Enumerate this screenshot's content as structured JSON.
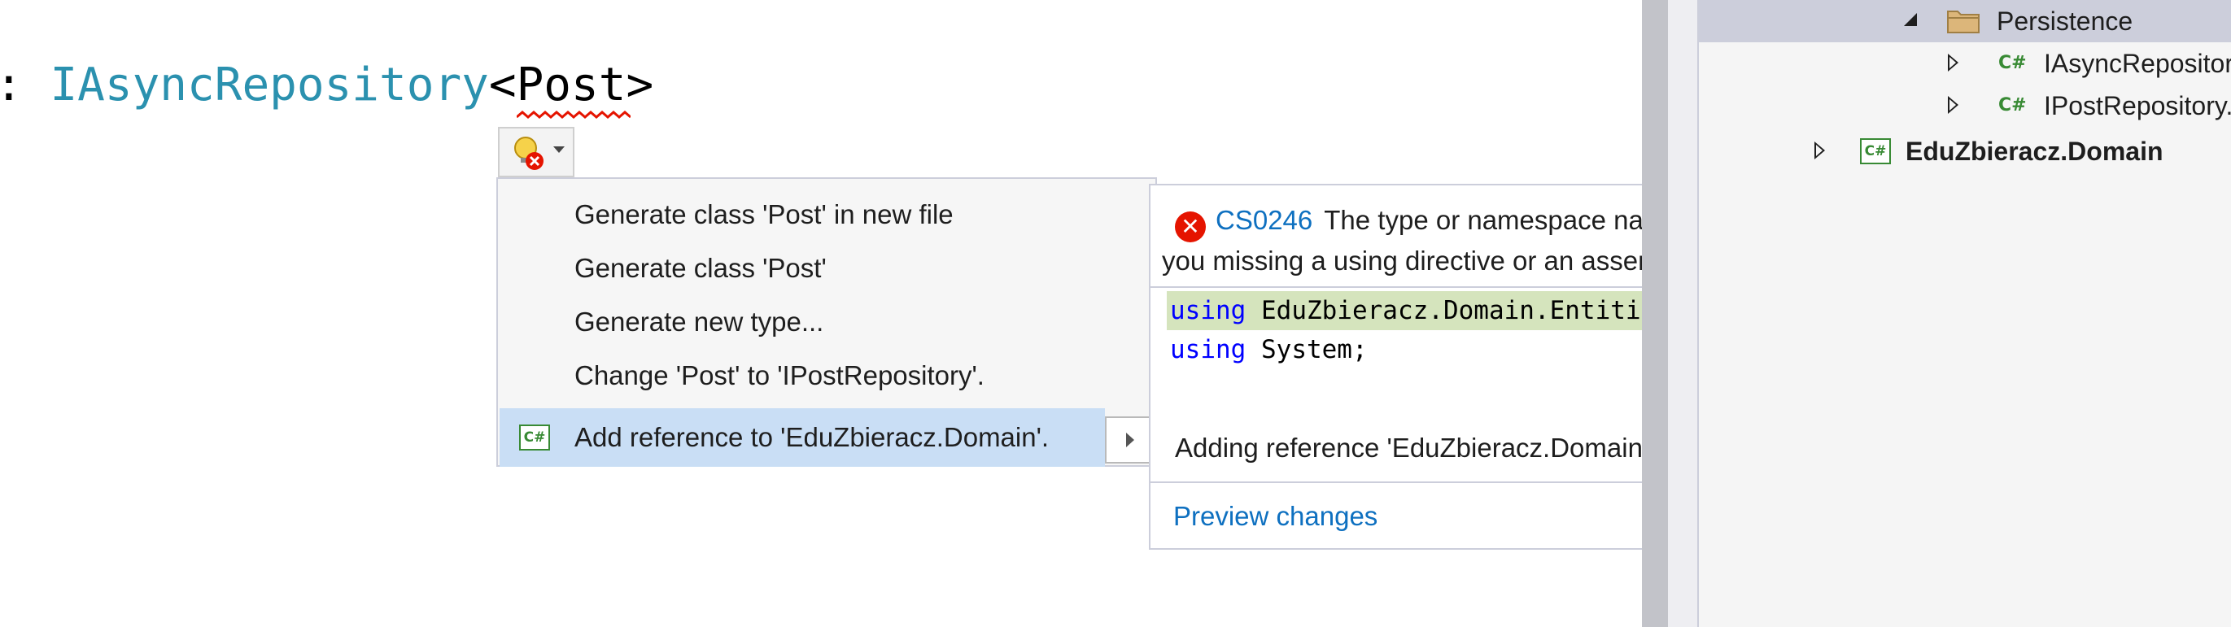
{
  "editor": {
    "code": {
      "colon": ": ",
      "interface": "IAsyncRepository",
      "open": "<",
      "type_arg": "Post",
      "close": ">"
    }
  },
  "quick_actions": {
    "items": [
      {
        "label": "Generate class 'Post' in new file"
      },
      {
        "label": "Generate class 'Post'"
      },
      {
        "label": "Generate new type..."
      },
      {
        "label": "Change 'Post' to 'IPostRepository'."
      },
      {
        "label": "Add reference to 'EduZbieracz.Domain'.",
        "icon": "csharp-project-icon",
        "selected": true
      }
    ]
  },
  "preview": {
    "error_code": "CS0246",
    "message_line1": "The type or namespace name 'Post' could not be found (are",
    "message_line2": "you missing a using directive or an assembly reference?)",
    "code_lines": [
      {
        "keyword": "using",
        "rest": " EduZbieracz.Domain.Entities;",
        "added": true
      },
      {
        "keyword": "using",
        "rest": " System;",
        "added": false
      }
    ],
    "reference_text": "Adding reference 'EduZbieracz.Domain' to 'EduZbieracz.Application'",
    "preview_link": "Preview changes"
  },
  "solution_explorer": {
    "rows": [
      {
        "label": "Persistence",
        "type": "folder",
        "expanded": true,
        "selected": true
      },
      {
        "label": "IAsyncRepository.cs",
        "type": "cs-file",
        "expanded": false
      },
      {
        "label": "IPostRepository.cs",
        "type": "cs-file",
        "expanded": false
      },
      {
        "label": "EduZbieracz.Domain",
        "type": "project",
        "expanded": false,
        "bold": true
      }
    ]
  },
  "colors": {
    "interface_type": "#2b91af",
    "keyword": "#0000ff",
    "link": "#0e70c0",
    "error": "#e51400",
    "added_line": "#d5e4bd",
    "menu_selected": "#c9def5"
  }
}
